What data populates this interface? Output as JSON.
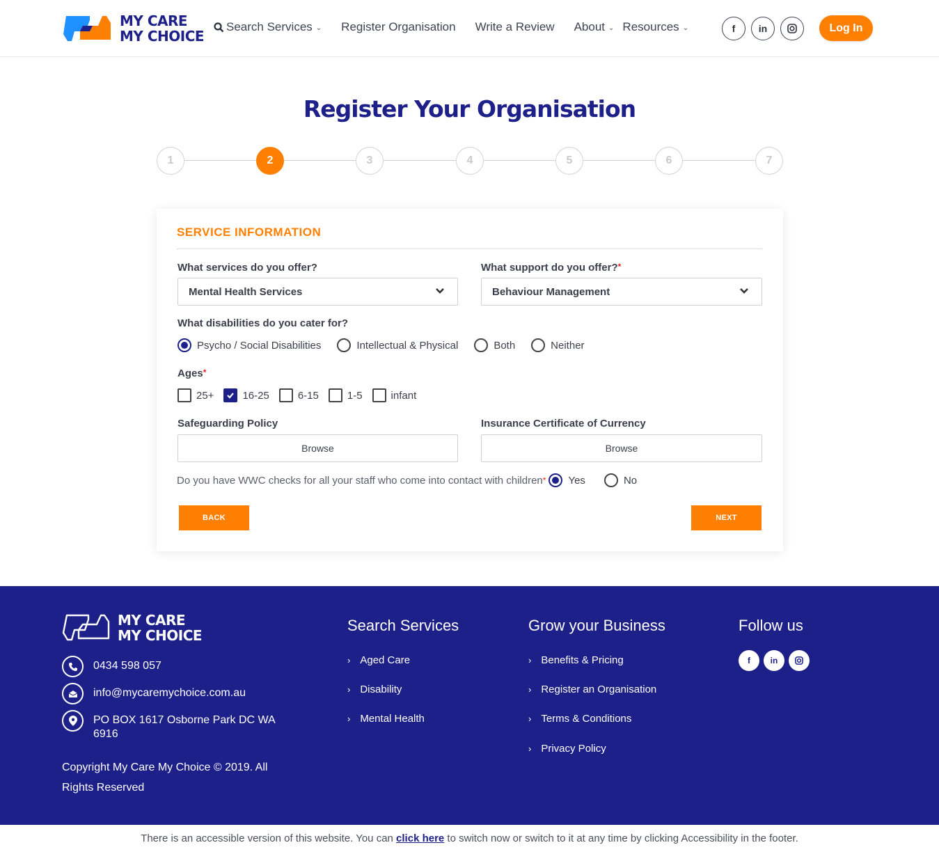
{
  "header": {
    "logo_line1": "MY CARE",
    "logo_line2": "MY CHOICE",
    "nav": [
      {
        "label": "Search Services",
        "icon": "search-icon",
        "dropdown": true
      },
      {
        "label": "Register Organisation",
        "dropdown": false
      },
      {
        "label": "Write a Review",
        "dropdown": false
      },
      {
        "label": "About",
        "dropdown": true
      },
      {
        "label": "Resources",
        "dropdown": true
      }
    ],
    "socials": [
      {
        "name": "facebook",
        "glyph": "f"
      },
      {
        "name": "linkedin",
        "glyph": "in"
      },
      {
        "name": "instagram",
        "glyph": "◎"
      }
    ],
    "login_label": "Log In"
  },
  "page_title": "Register Your Organisation",
  "stepper": {
    "steps": [
      "1",
      "2",
      "3",
      "4",
      "5",
      "6",
      "7"
    ],
    "current": 2
  },
  "form": {
    "section_title": "SERVICE INFORMATION",
    "services_label": "What services do you offer?",
    "services_value": "Mental Health Services",
    "support_label": "What support do you offer?",
    "support_required": "*",
    "support_value": "Behaviour Management",
    "disabilities_label": "What disabilities do you cater for?",
    "disabilities": [
      {
        "label": "Psycho / Social Disabilities",
        "selected": true
      },
      {
        "label": "Intellectual & Physical",
        "selected": false
      },
      {
        "label": "Both",
        "selected": false
      },
      {
        "label": "Neither",
        "selected": false
      }
    ],
    "ages_label": "Ages",
    "ages_required": "*",
    "ages": [
      {
        "label": "25+",
        "checked": false
      },
      {
        "label": "16-25",
        "checked": true
      },
      {
        "label": "6-15",
        "checked": false
      },
      {
        "label": "1-5",
        "checked": false
      },
      {
        "label": "infant",
        "checked": false
      }
    ],
    "safeguarding_label": "Safeguarding Policy",
    "safeguarding_button": "Browse",
    "insurance_label": "Insurance Certificate of Currency",
    "insurance_button": "Browse",
    "wwc_question": "Do you have WWC checks for all your staff who come into contact with children",
    "wwc_required": "*",
    "wwc_options": [
      {
        "label": "Yes",
        "selected": true
      },
      {
        "label": "No",
        "selected": false
      }
    ],
    "back_label": "BACK",
    "next_label": "NEXT"
  },
  "footer": {
    "logo_line1": "MY CARE",
    "logo_line2": "MY CHOICE",
    "phone": "0434 598 057",
    "email": "info@mycaremychoice.com.au",
    "address": "PO BOX 1617 Osborne Park DC WA 6916",
    "copyright": "Copyright My Care My Choice © 2019. All Rights Reserved",
    "search_heading": "Search Services",
    "search_links": [
      "Aged Care",
      "Disability",
      "Mental Health"
    ],
    "grow_heading": "Grow your Business",
    "grow_links": [
      "Benefits & Pricing",
      "Register an Organisation",
      "Terms & Conditions",
      "Privacy Policy"
    ],
    "follow_heading": "Follow us",
    "socials": [
      {
        "name": "facebook",
        "glyph": "f"
      },
      {
        "name": "linkedin",
        "glyph": "in"
      },
      {
        "name": "instagram",
        "glyph": "◎"
      }
    ]
  },
  "accessibility": {
    "before": "There is an accessible version of this website. You can ",
    "link": "click here",
    "after": " to switch now or switch to it at any time by clicking Accessibility in the footer."
  },
  "colors": {
    "brand_navy": "#1d2088",
    "brand_orange": "#ff7f00",
    "brand_blue": "#1e90ff"
  }
}
